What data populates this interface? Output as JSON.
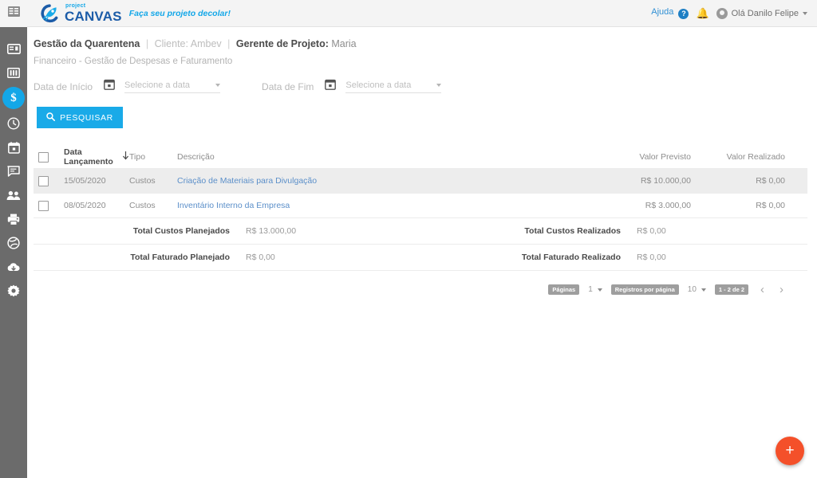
{
  "colors": {
    "accent_blue": "#19aae8",
    "logo_blue": "#1c5ca8",
    "sidebar_gray": "#6b6b6b",
    "fab_orange": "#f4502a",
    "bell_red": "#f04e23",
    "link_blue": "#5b8fc9"
  },
  "topbar": {
    "menu_icon": "dashboard-grid-icon",
    "logo_project": "project",
    "logo_canvas": "CANVAS",
    "tagline": "Faça seu projeto decolar!",
    "help_label": "Ajuda",
    "help_badge": "?",
    "bell_icon": "notification-bell-icon",
    "user_greeting": "Olá Danilo Felipe"
  },
  "sidebar": {
    "items": [
      {
        "icon": "card-board-icon",
        "name": "sidebar-item-board"
      },
      {
        "icon": "columns-icon",
        "name": "sidebar-item-columns"
      },
      {
        "icon": "dollar-icon",
        "name": "sidebar-item-financeiro",
        "active": true,
        "glyph": "$"
      },
      {
        "icon": "clock-icon",
        "name": "sidebar-item-clock"
      },
      {
        "icon": "calendar-icon",
        "name": "sidebar-item-calendar"
      },
      {
        "icon": "chat-icon",
        "name": "sidebar-item-chat"
      },
      {
        "icon": "users-icon",
        "name": "sidebar-item-users"
      },
      {
        "icon": "printer-icon",
        "name": "sidebar-item-print"
      },
      {
        "icon": "globe-icon",
        "name": "sidebar-item-globe"
      },
      {
        "icon": "cloud-download-icon",
        "name": "sidebar-item-cloud"
      },
      {
        "icon": "gear-icon",
        "name": "sidebar-item-settings"
      }
    ]
  },
  "header": {
    "project_title": "Gestão da Quarentena",
    "separator": "|",
    "client_label": "Cliente: Ambev",
    "pm_label": "Gerente de Projeto:",
    "pm_name": "Maria",
    "subtitle": "Financeiro - Gestão de Despesas e Faturamento"
  },
  "filters": {
    "start_label": "Data de Início",
    "start_calendar_icon": "calendar-icon",
    "start_value": "Selecione a data",
    "end_label": "Data de Fim",
    "end_calendar_icon": "calendar-icon",
    "end_value": "Selecione a data",
    "search_button": "PESQUISAR",
    "search_icon": "search-icon"
  },
  "table": {
    "columns": {
      "date": "Data Lançamento",
      "sort_icon": "sort-desc-arrow-icon",
      "type": "Tipo",
      "description": "Descrição",
      "previsto": "Valor Previsto",
      "realizado": "Valor Realizado"
    },
    "rows": [
      {
        "date": "15/05/2020",
        "type": "Custos",
        "description": "Criação de Materiais para Divulgação",
        "previsto": "R$ 10.000,00",
        "realizado": "R$ 0,00",
        "highlighted": true
      },
      {
        "date": "08/05/2020",
        "type": "Custos",
        "description": "Inventário Interno da Empresa",
        "previsto": "R$ 3.000,00",
        "realizado": "R$ 0,00",
        "highlighted": false
      }
    ],
    "totals": [
      {
        "left_label": "Total Custos Planejados",
        "left_value": "R$ 13.000,00",
        "right_label": "Total Custos Realizados",
        "right_value": "R$ 0,00"
      },
      {
        "left_label": "Total Faturado Planejado",
        "left_value": "R$ 0,00",
        "right_label": "Total Faturado Realizado",
        "right_value": "R$ 0,00"
      }
    ]
  },
  "pagination": {
    "pages_badge": "Páginas",
    "page_value": "1",
    "per_page_badge": "Registros por página",
    "per_page_value": "10",
    "range_badge": "1 - 2 de 2",
    "prev_icon": "chevron-left-icon",
    "next_icon": "chevron-right-icon"
  },
  "fab": {
    "label": "+",
    "icon": "plus-icon"
  }
}
